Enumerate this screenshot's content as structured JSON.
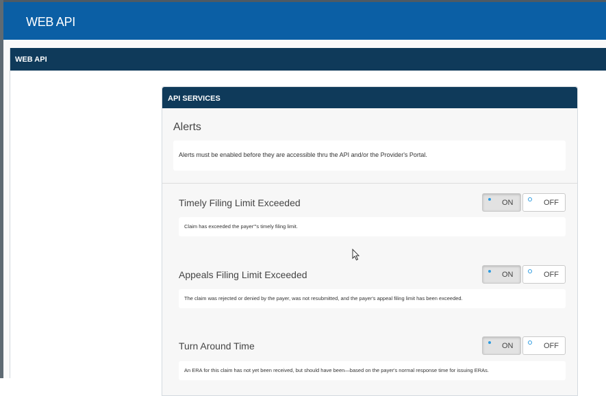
{
  "app": {
    "title": "WEB API"
  },
  "section": {
    "title": "WEB API"
  },
  "api_services": {
    "header": "API SERVICES",
    "alerts_title": "Alerts",
    "alerts_note": "Alerts must be enabled before they are accessible thru the API and/or the Provider's Portal."
  },
  "alerts": [
    {
      "title": "Timely Filing Limit Exceeded",
      "description": "Claim has exceeded the payer'\"s timely filing limit.",
      "on_label": "ON",
      "off_label": "OFF",
      "state": "ON"
    },
    {
      "title": "Appeals Filing Limit Exceeded",
      "description": "The claim was rejected or denied by the payer, was not resubmitted, and the payer's appeal filing limit has been exceeded.",
      "on_label": "ON",
      "off_label": "OFF",
      "state": "ON"
    },
    {
      "title": "Turn Around Time",
      "description": "An ERA for this claim has not yet been received, but should have been—based on the payer's normal response time for issuing ERAs.",
      "on_label": "ON",
      "off_label": "OFF",
      "state": "ON"
    }
  ],
  "colors": {
    "header_blue": "#0b5fa5",
    "section_navy": "#0f3a5a",
    "radio_blue": "#2d9be0"
  }
}
